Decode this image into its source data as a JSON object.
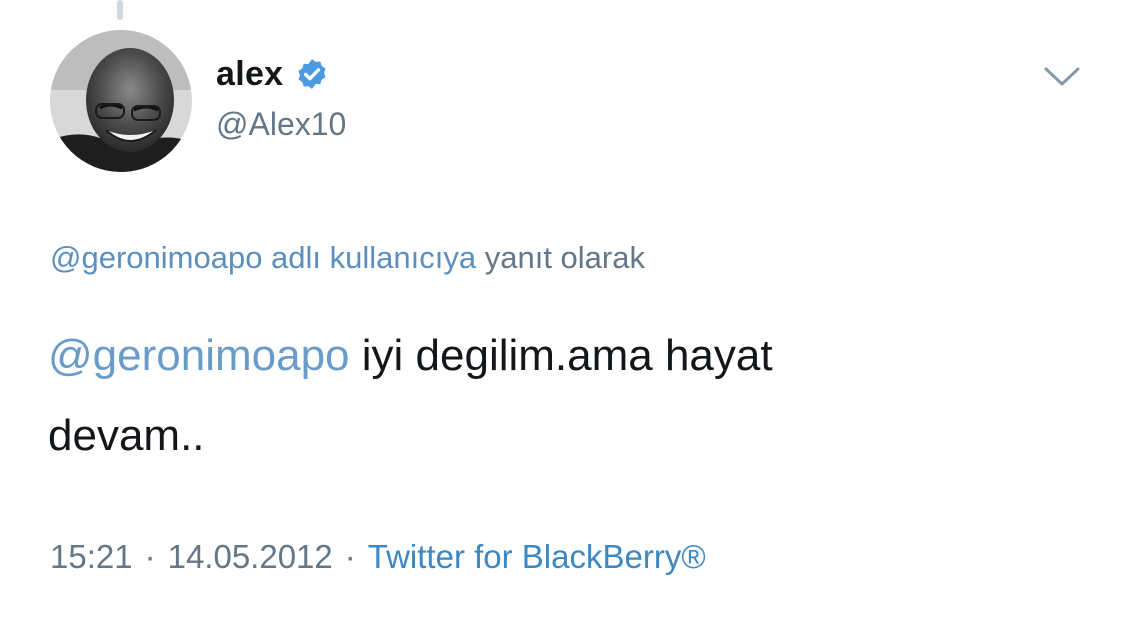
{
  "tweet": {
    "author": {
      "display_name": "alex",
      "handle": "@Alex10",
      "verified": true
    },
    "reply_context": {
      "mention_link": "@geronimoapo adlı kullanıcıya",
      "suffix": "yanıt olarak"
    },
    "text": {
      "mention": "@geronimoapo",
      "line1_rest": "iyi degilim.ama hayat",
      "line2": "devam.."
    },
    "meta": {
      "time": "15:21",
      "separator": "·",
      "date": "14.05.2012",
      "source": "Twitter for BlackBerry®"
    },
    "icons": {
      "verified": "verified-badge-icon",
      "menu": "chevron-down-icon"
    }
  },
  "colors": {
    "link": "#5a8fbf",
    "verified": "#4a9be0",
    "secondary_text": "#657786",
    "primary_text": "#14171a"
  }
}
